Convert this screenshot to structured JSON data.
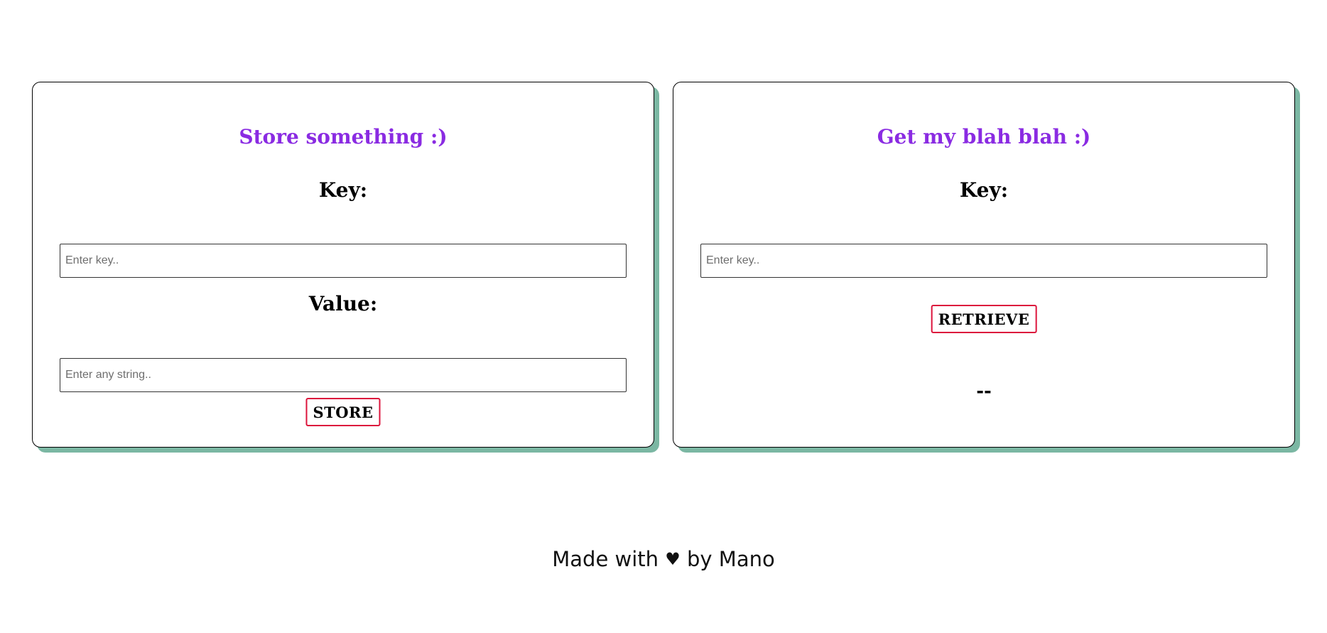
{
  "store_card": {
    "title": "Store something :)",
    "key_label": "Key:",
    "key_placeholder": "Enter key..",
    "value_label": "Value:",
    "value_placeholder": "Enter any string..",
    "button_label": "STORE"
  },
  "retrieve_card": {
    "title": "Get my blah blah :)",
    "key_label": "Key:",
    "key_placeholder": "Enter key..",
    "button_label": "RETRIEVE",
    "result": "--"
  },
  "footer": {
    "prefix": "Made with",
    "heart": "♥",
    "suffix": "by Mano"
  },
  "colors": {
    "title": "#8a2be2",
    "button_border": "#dc143c",
    "card_shadow": "#7bb7a3"
  }
}
